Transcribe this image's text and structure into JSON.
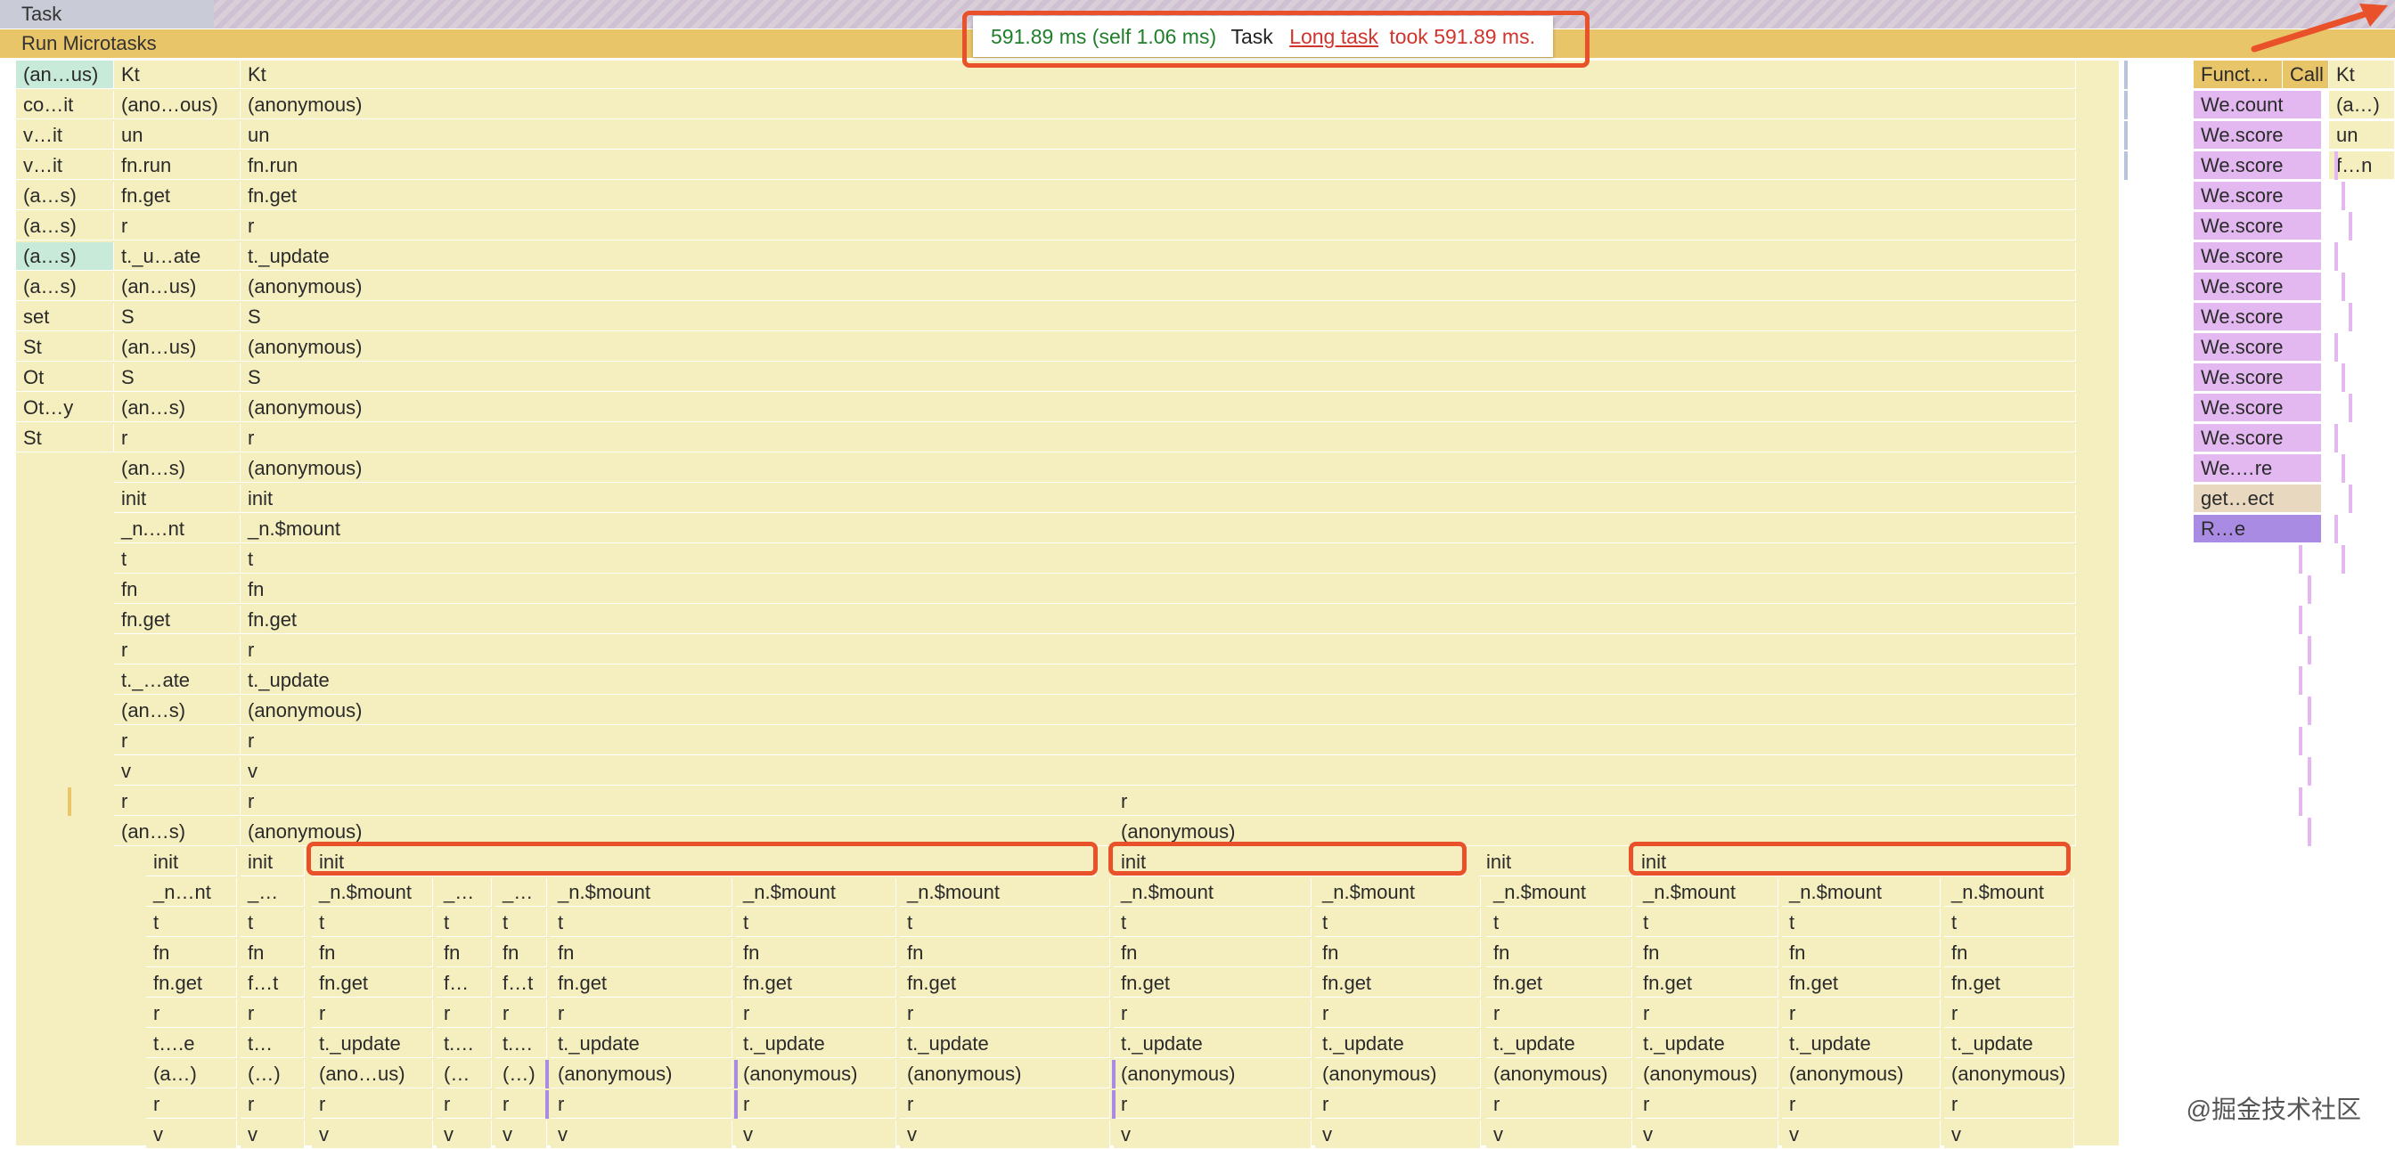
{
  "task_label": "Task",
  "microtasks_label": "Run Microtasks",
  "tooltip": {
    "time": "591.89 ms (self 1.06 ms)",
    "task": "Task",
    "link": "Long task",
    "rest": "took 591.89 ms."
  },
  "watermark": "@掘金技术社区",
  "colors": {
    "frame": "#f5eebf",
    "frame_dark": "#ece4a6",
    "micro": "#e9c56a",
    "purple": "#e3b8f0",
    "purple_dark": "#a98be3",
    "teal": "#c8ead9",
    "orange": "#e8512a",
    "tan": "#e7d8bf"
  },
  "flame": {
    "col_a": [
      "(an…us)",
      "co…it",
      "v…it",
      "v…it",
      "(a…s)",
      "(a…s)",
      "(a…s)",
      "(a…s)",
      "set",
      "St",
      "Ot",
      "Ot…y",
      "St"
    ],
    "col_b": [
      "Kt",
      "(ano…ous)",
      "un",
      "fn.run",
      "fn.get",
      "r",
      "t._u…ate",
      "(an…us)",
      "S",
      "(an…us)",
      "S",
      "(an…s)",
      "r",
      "(an…s)",
      "init",
      "_n.…nt",
      "t",
      "fn",
      "fn.get",
      "r",
      "t._…ate",
      "(an…s)",
      "r",
      "v",
      "r",
      "(an…s)",
      "init",
      "_n…nt",
      "t",
      "fn",
      "fn.get",
      "r",
      "t….e",
      "(a…)",
      "r",
      "v"
    ],
    "col_c": [
      "Kt",
      "(anonymous)",
      "un",
      "fn.run",
      "fn.get",
      "r",
      "t._update",
      "(anonymous)",
      "S",
      "(anonymous)",
      "S",
      "(anonymous)",
      "r",
      "(anonymous)",
      "init",
      "_n.$mount",
      "t",
      "fn",
      "fn.get",
      "r",
      "t._update",
      "(anonymous)",
      "r",
      "v",
      "r",
      "(anonymous)",
      "init",
      "_…",
      "t",
      "fn",
      "f…t",
      "r",
      "t…",
      "(…)",
      "r",
      "v"
    ],
    "init_row": [
      "init",
      "init",
      "init",
      "init"
    ],
    "mount_cols": [
      {
        "label": "_n.$mount",
        "stack": [
          "t",
          "fn",
          "fn.get",
          "r",
          "t._update",
          "(ano…us)",
          "r",
          "v"
        ]
      },
      {
        "label": "_…",
        "stack": [
          "t",
          "fn",
          "f…",
          "r",
          "t.…",
          "(…",
          "r",
          "v"
        ]
      },
      {
        "label": "_…",
        "stack": [
          "t",
          "fn",
          "f…t",
          "r",
          "t.…",
          "(…)",
          "r",
          "v"
        ]
      },
      {
        "label": "_n.$mount",
        "stack": [
          "t",
          "fn",
          "fn.get",
          "r",
          "t._update",
          "(anonymous)",
          "r",
          "v"
        ]
      },
      {
        "label": "_n.$mount",
        "stack": [
          "t",
          "fn",
          "fn.get",
          "r",
          "t._update",
          "(anonymous)",
          "r",
          "v"
        ]
      },
      {
        "label": "_n.$mount",
        "stack": [
          "t",
          "fn",
          "fn.get",
          "r",
          "t._update",
          "(anonymous)",
          "r",
          "v"
        ]
      },
      {
        "label": "_n.$mount",
        "stack": [
          "t",
          "fn",
          "fn.get",
          "r",
          "t._update",
          "(anonymous)",
          "r",
          "v"
        ]
      },
      {
        "label": "_n.$mount",
        "stack": [
          "t",
          "fn",
          "fn.get",
          "r",
          "t._update",
          "(anonymous)",
          "r",
          "v"
        ]
      },
      {
        "label": "_n.$mount",
        "stack": [
          "t",
          "fn",
          "fn.get",
          "r",
          "t._update",
          "(anonymous)",
          "r",
          "v"
        ]
      },
      {
        "label": "_n.$mount",
        "stack": [
          "t",
          "fn",
          "fn.get",
          "r",
          "t._update",
          "(anonymous)",
          "r",
          "v"
        ]
      },
      {
        "label": "_n.$mount",
        "stack": [
          "t",
          "fn",
          "fn.get",
          "r",
          "t._update",
          "(anonymous)",
          "r",
          "v"
        ]
      },
      {
        "label": "_n.$mount",
        "stack": [
          "t",
          "fn",
          "fn.get",
          "r",
          "t._update",
          "(anonymous)",
          "r",
          "v"
        ]
      }
    ],
    "mid_r": "r",
    "mid_anon": "(anonymous)",
    "right_header": [
      "Funct…",
      "Call",
      "Kt"
    ],
    "right_col": [
      "We.count",
      "We.score",
      "We.score",
      "We.score",
      "We.score",
      "We.score",
      "We.score",
      "We.score",
      "We.score",
      "We.score",
      "We.score",
      "We.score",
      "We.…re",
      "get…ect",
      "R…e"
    ],
    "right_kt": [
      "(a…)",
      "un",
      "f…n"
    ]
  }
}
